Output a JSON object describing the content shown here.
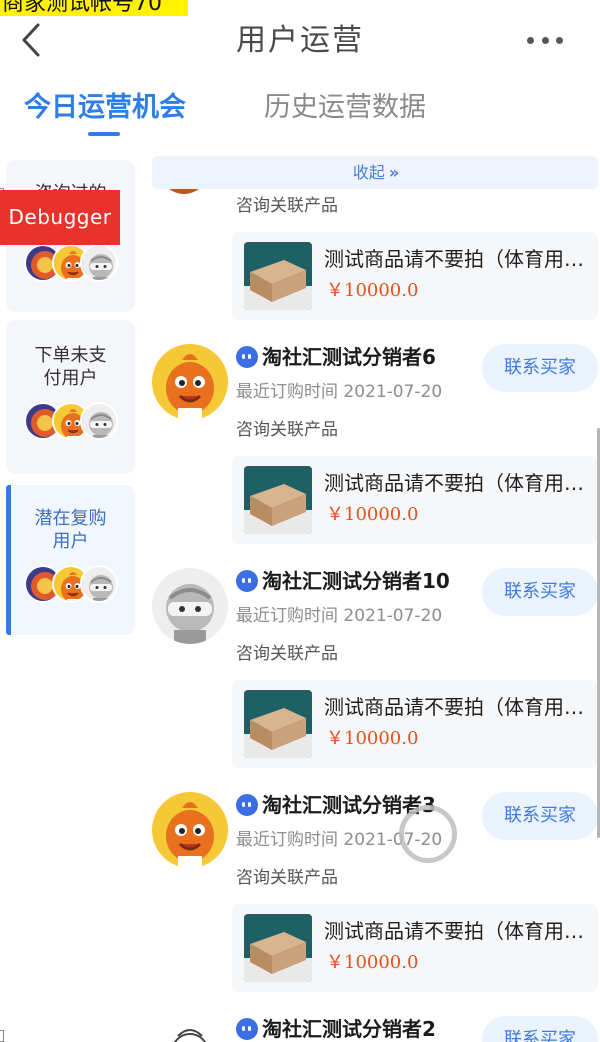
{
  "debug_banner": "商家测试帐号70",
  "nav": {
    "title": "用户运营"
  },
  "tabs": [
    {
      "label": "今日运营机会",
      "active": true
    },
    {
      "label": "历史运营数据",
      "active": false
    }
  ],
  "sidebar": {
    "items": [
      {
        "label": "咨询过的用户",
        "active": false
      },
      {
        "label": "下单未支付用户",
        "active": false
      },
      {
        "label": "潜在复购用户",
        "active": true
      }
    ]
  },
  "debugger_label": "Debugger",
  "collapse": {
    "label": "收起"
  },
  "entries": [
    {
      "name": "",
      "last_order_label": "",
      "related_label": "咨询关联产品",
      "product": {
        "title": "测试商品请不要拍（体育用品）",
        "price": "￥10000.0"
      }
    },
    {
      "name": "淘社汇测试分销者6",
      "last_order_label": "最近订购时间 2021-07-20",
      "related_label": "咨询关联产品",
      "contact_label": "联系买家",
      "avatar": "orange-character",
      "product": {
        "title": "测试商品请不要拍（体育用品）",
        "price": "￥10000.0"
      }
    },
    {
      "name": "淘社汇测试分销者10",
      "last_order_label": "最近订购时间 2021-07-20",
      "related_label": "咨询关联产品",
      "contact_label": "联系买家",
      "avatar": "gray-ninja",
      "product": {
        "title": "测试商品请不要拍（体育用品）",
        "price": "￥10000.0"
      }
    },
    {
      "name": "淘社汇测试分销者3",
      "last_order_label": "最近订购时间 2021-07-20",
      "related_label": "咨询关联产品",
      "contact_label": "联系买家",
      "avatar": "orange-character",
      "product": {
        "title": "测试商品请不要拍（体育用品）",
        "price": "￥10000.0"
      }
    },
    {
      "name": "淘社汇测试分销者2",
      "contact_label": "联系买家",
      "avatar": "line-drawing"
    }
  ],
  "colors": {
    "accent": "#2f7ee8",
    "price": "#e2531f",
    "debugger": "#e9322c",
    "banner": "#fff100"
  }
}
